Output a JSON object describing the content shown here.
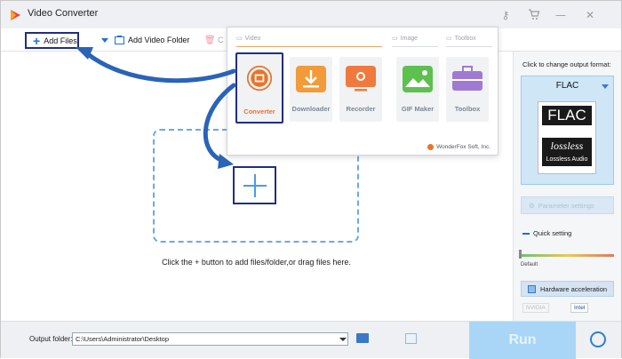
{
  "titlebar": {
    "title": "Video Converter",
    "icons": [
      "key-icon",
      "cart-icon",
      "minimize-icon",
      "close-icon"
    ],
    "icon_glyphs": [
      "⚷",
      "🛒",
      "—",
      "✕"
    ]
  },
  "toolbar": {
    "add_files_label": "Add Files",
    "add_video_folder_label": "Add Video Folder",
    "clear_label": "C"
  },
  "main": {
    "hint": "Click the + button to add files/folder,or drag files here."
  },
  "popup": {
    "categories": {
      "video": "Video",
      "image": "Image",
      "toolbox": "Toolbox"
    },
    "tiles": [
      {
        "label": "Converter",
        "icon": "converter-icon",
        "color": "#e8742b",
        "selected": true
      },
      {
        "label": "Downloader",
        "icon": "downloader-icon",
        "color": "#f39a3a",
        "selected": false
      },
      {
        "label": "Recorder",
        "icon": "recorder-icon",
        "color": "#f07a3e",
        "selected": false
      },
      {
        "label": "GIF Maker",
        "icon": "gif-maker-icon",
        "color": "#5ec04e",
        "selected": false
      },
      {
        "label": "Toolbox",
        "icon": "toolbox-icon",
        "color": "#a07ad2",
        "selected": false
      }
    ],
    "footer": "WonderFox Soft, Inc."
  },
  "right_panel": {
    "caption": "Click to change output format:",
    "format": "FLAC",
    "badge_top": "FLAC",
    "badge_mid": "lossless",
    "badge_bottom": "Lossless Audio",
    "parameter_settings_label": "Parameter settings",
    "quick_setting_label": "Quick setting",
    "slider_level": 0.05,
    "default_label": "Default",
    "hw_accel_label": "Hardware acceleration",
    "nvidia_label": "NVIDIA",
    "intel_label": "Intel"
  },
  "bottom": {
    "output_folder_label": "Output folder:",
    "output_folder_value": "C:\\Users\\Administrator\\Desktop",
    "run_label": "Run"
  },
  "colors": {
    "accent_blue": "#1f6fd6",
    "annotation_navy": "#1f2f7f",
    "run_button": "#a9d6f6",
    "converter_orange": "#e8742b"
  }
}
